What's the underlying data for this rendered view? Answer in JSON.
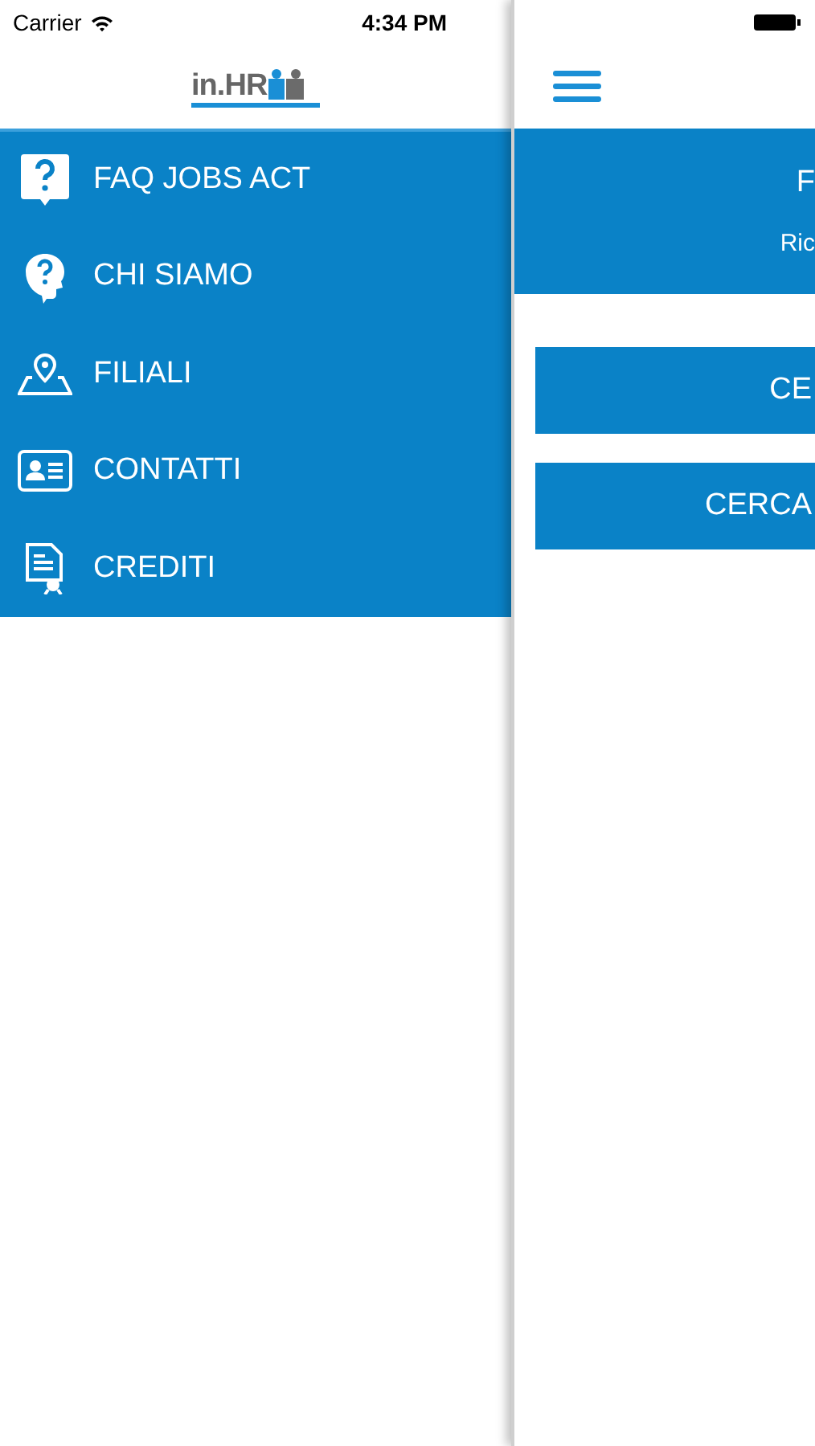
{
  "status_bar": {
    "carrier": "Carrier",
    "time": "4:34 PM"
  },
  "drawer": {
    "logo": "in.HR",
    "items": [
      {
        "kind": "faq",
        "label": "FAQ JOBS ACT"
      },
      {
        "kind": "about",
        "label": "CHI SIAMO"
      },
      {
        "kind": "map",
        "label": "FILIALI"
      },
      {
        "kind": "contact",
        "label": "CONTATTI"
      },
      {
        "kind": "credits",
        "label": "CREDITI"
      }
    ]
  },
  "main": {
    "header": {
      "title": "F",
      "subtitle": "Ric"
    },
    "buttons": [
      "CE",
      "CERCA"
    ]
  }
}
